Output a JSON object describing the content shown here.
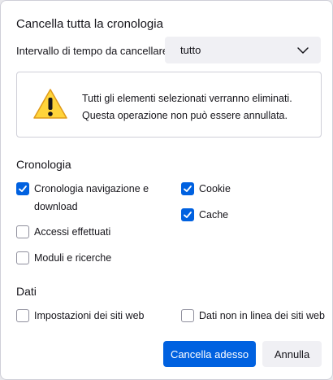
{
  "dialog": {
    "title": "Cancella tutta la cronologia",
    "range_label": "Intervallo di tempo da cancellare:",
    "range_value": "tutto",
    "warning_line1": "Tutti gli elementi selezionati verranno eliminati.",
    "warning_line2": "Questa operazione non può essere annullata."
  },
  "history": {
    "heading": "Cronologia",
    "items": [
      {
        "label_line1": "Cronologia navigazione e",
        "label_line2": "download",
        "checked": true
      },
      {
        "label": "Cookie",
        "checked": true
      },
      {
        "label": "Cache",
        "checked": true
      },
      {
        "label": "Accessi effettuati",
        "checked": false
      },
      {
        "label": "Moduli e ricerche",
        "checked": false
      }
    ]
  },
  "data_section": {
    "heading": "Dati",
    "items": [
      {
        "label": "Impostazioni dei siti web",
        "checked": false
      },
      {
        "label": "Dati non in linea dei siti web",
        "checked": false
      }
    ]
  },
  "buttons": {
    "primary": "Cancella adesso",
    "secondary": "Annulla"
  },
  "colors": {
    "accent": "#0061e0",
    "warning": "#ffa436"
  },
  "icons": [
    "chevron-down-icon",
    "warning-icon",
    "checkmark-icon"
  ]
}
